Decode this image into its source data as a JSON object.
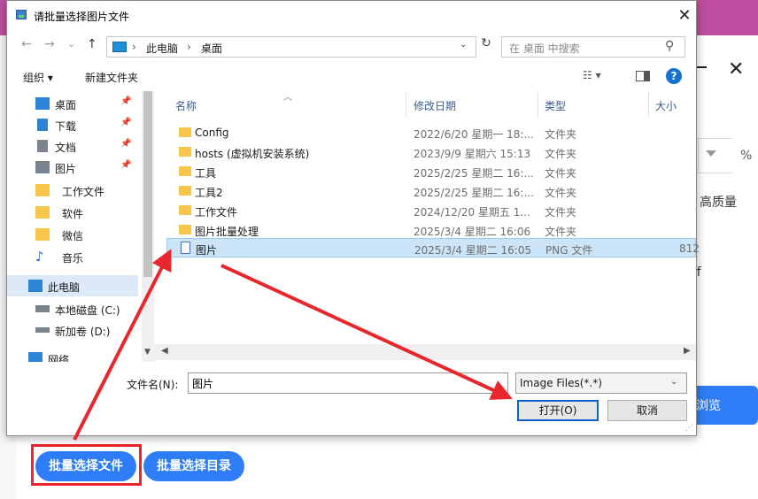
{
  "background_app": {
    "browse_label": "浏览",
    "quality_label": "高质量",
    "percent_label": "%",
    "partial_text": "ff",
    "batch_files_label": "批量选择文件",
    "batch_dir_label": "批量选择目录",
    "accent_color": "#2f7df6",
    "topbar_color": "#c04ea0"
  },
  "dialog": {
    "title": "请批量选择图片文件",
    "close_glyph": "✕",
    "nav": {
      "back_glyph": "←",
      "forward_glyph": "→",
      "recent_glyph": "⌄",
      "up_glyph": "↑",
      "breadcrumb": [
        "此电脑",
        "桌面"
      ],
      "separator": "›",
      "refresh_glyph": "↻",
      "search_placeholder": "在 桌面 中搜索",
      "search_glyph": "⚲"
    },
    "toolbar": {
      "organize_label": "组织 ▾",
      "new_folder_label": "新建文件夹",
      "view_glyph": "☷ ▾",
      "help_glyph": "?"
    },
    "nav_pane": [
      {
        "label": "桌面",
        "icon": "desktop-icon",
        "pinned": true
      },
      {
        "label": "下载",
        "icon": "download-icon",
        "pinned": true
      },
      {
        "label": "文档",
        "icon": "document-icon",
        "pinned": true
      },
      {
        "label": "图片",
        "icon": "picture-icon",
        "pinned": true
      },
      {
        "label": "工作文件",
        "icon": "folder-icon",
        "pinned": false
      },
      {
        "label": "软件",
        "icon": "folder-icon",
        "pinned": false
      },
      {
        "label": "微信",
        "icon": "folder-icon",
        "pinned": false
      },
      {
        "label": "音乐",
        "icon": "music-icon",
        "pinned": false
      },
      {
        "label": "此电脑",
        "icon": "computer-icon",
        "pinned": false,
        "selected": true
      },
      {
        "label": "本地磁盘 (C:)",
        "icon": "drive-icon",
        "pinned": false
      },
      {
        "label": "新加卷 (D:)",
        "icon": "drive-icon",
        "pinned": false
      },
      {
        "label": "网络",
        "icon": "network-icon",
        "pinned": false
      }
    ],
    "columns": [
      "名称",
      "修改日期",
      "类型",
      "大小"
    ],
    "files": [
      {
        "name": "Config",
        "date": "2022/6/20 星期一 18:...",
        "type": "文件夹",
        "size": "",
        "kind": "folder"
      },
      {
        "name": "hosts (虚拟机安装系统)",
        "date": "2023/9/9 星期六 15:13",
        "type": "文件夹",
        "size": "",
        "kind": "folder"
      },
      {
        "name": "工具",
        "date": "2025/2/25 星期二 16:...",
        "type": "文件夹",
        "size": "",
        "kind": "folder"
      },
      {
        "name": "工具2",
        "date": "2025/2/25 星期二 16:...",
        "type": "文件夹",
        "size": "",
        "kind": "folder"
      },
      {
        "name": "工作文件",
        "date": "2024/12/20 星期五 1...",
        "type": "文件夹",
        "size": "",
        "kind": "folder"
      },
      {
        "name": "图片批量处理",
        "date": "2025/3/4 星期二 16:06",
        "type": "文件夹",
        "size": "",
        "kind": "folder"
      },
      {
        "name": "图片",
        "date": "2025/3/4 星期二 16:05",
        "type": "PNG 文件",
        "size": "812",
        "kind": "png",
        "selected": true
      }
    ],
    "filename_label": "文件名(N):",
    "filename_value": "图片",
    "filetype_value": "Image Files(*.*)",
    "open_label": "打开(O)",
    "cancel_label": "取消"
  },
  "annotation_color": "#e8262b"
}
